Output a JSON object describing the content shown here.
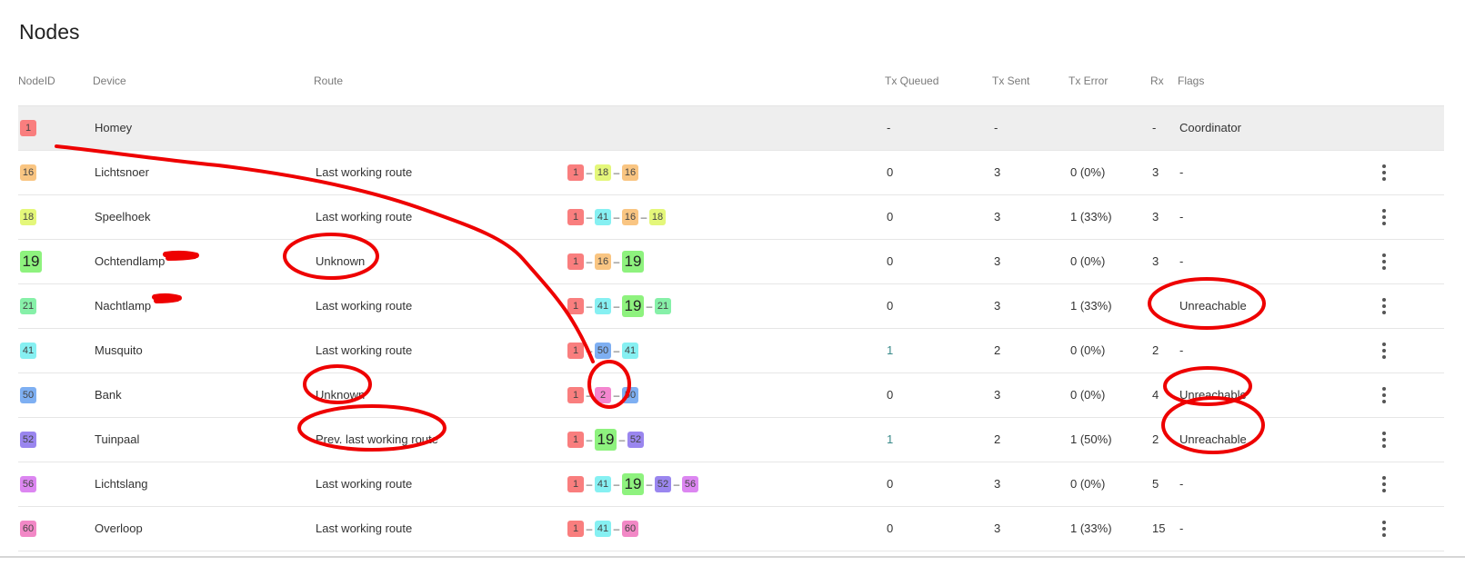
{
  "page": {
    "title": "Nodes"
  },
  "columns": {
    "node_id": "NodeID",
    "device": "Device",
    "route": "Route",
    "tx_queued": "Tx Queued",
    "tx_sent": "Tx Sent",
    "tx_error": "Tx Error",
    "rx": "Rx",
    "flags": "Flags"
  },
  "node_colors": {
    "1": "#f97e7e",
    "2": "#f486cf",
    "16": "#f9c582",
    "18": "#e4f77a",
    "19": "#8ef27e",
    "21": "#86f0a8",
    "41": "#86f0f2",
    "50": "#7eaff2",
    "52": "#9a86ef",
    "56": "#dc86f1",
    "60": "#f288c6"
  },
  "large_nodes": [
    "19"
  ],
  "rows": [
    {
      "id": "1",
      "device": "Homey",
      "route": "",
      "path": [],
      "tx_queued": "-",
      "tx_sent": "-",
      "tx_error": "",
      "rx": "-",
      "flags": "Coordinator",
      "menu": false
    },
    {
      "id": "16",
      "device": "Lichtsnoer",
      "route": "Last working route",
      "path": [
        "1",
        "18",
        "16"
      ],
      "tx_queued": "0",
      "tx_sent": "3",
      "tx_error": "0 (0%)",
      "rx": "3",
      "flags": "-",
      "menu": true
    },
    {
      "id": "18",
      "device": "Speelhoek",
      "route": "Last working route",
      "path": [
        "1",
        "41",
        "16",
        "18"
      ],
      "tx_queued": "0",
      "tx_sent": "3",
      "tx_error": "1 (33%)",
      "rx": "3",
      "flags": "-",
      "menu": true
    },
    {
      "id": "19",
      "device": "Ochtendlamp",
      "route": "Unknown",
      "path": [
        "1",
        "16",
        "19"
      ],
      "tx_queued": "0",
      "tx_sent": "3",
      "tx_error": "0 (0%)",
      "rx": "3",
      "flags": "-",
      "menu": true
    },
    {
      "id": "21",
      "device": "Nachtlamp",
      "route": "Last working route",
      "path": [
        "1",
        "41",
        "19",
        "21"
      ],
      "tx_queued": "0",
      "tx_sent": "3",
      "tx_error": "1 (33%)",
      "rx": "",
      "flags": "Unreachable",
      "menu": true
    },
    {
      "id": "41",
      "device": "Musquito",
      "route": "Last working route",
      "path": [
        "1",
        "50",
        "41"
      ],
      "tx_queued": "1",
      "tx_sent": "2",
      "tx_error": "0 (0%)",
      "rx": "2",
      "flags": "-",
      "menu": true
    },
    {
      "id": "50",
      "device": "Bank",
      "route": "Unknown",
      "path": [
        "1",
        "2",
        "50"
      ],
      "tx_queued": "0",
      "tx_sent": "3",
      "tx_error": "0 (0%)",
      "rx": "4",
      "flags": "Unreachable",
      "menu": true
    },
    {
      "id": "52",
      "device": "Tuinpaal",
      "route": "Prev. last working route",
      "path": [
        "1",
        "19",
        "52"
      ],
      "tx_queued": "1",
      "tx_sent": "2",
      "tx_error": "1 (50%)",
      "rx": "2",
      "flags": "Unreachable",
      "menu": true
    },
    {
      "id": "56",
      "device": "Lichtslang",
      "route": "Last working route",
      "path": [
        "1",
        "41",
        "19",
        "52",
        "56"
      ],
      "tx_queued": "0",
      "tx_sent": "3",
      "tx_error": "0 (0%)",
      "rx": "5",
      "flags": "-",
      "menu": true
    },
    {
      "id": "60",
      "device": "Overloop",
      "route": "Last working route",
      "path": [
        "1",
        "41",
        "60"
      ],
      "tx_queued": "0",
      "tx_sent": "3",
      "tx_error": "1 (33%)",
      "rx": "15",
      "flags": "-",
      "menu": true
    }
  ],
  "icons": {
    "row_menu": "more-vert-icon"
  },
  "annotation_color": "#ee0000"
}
